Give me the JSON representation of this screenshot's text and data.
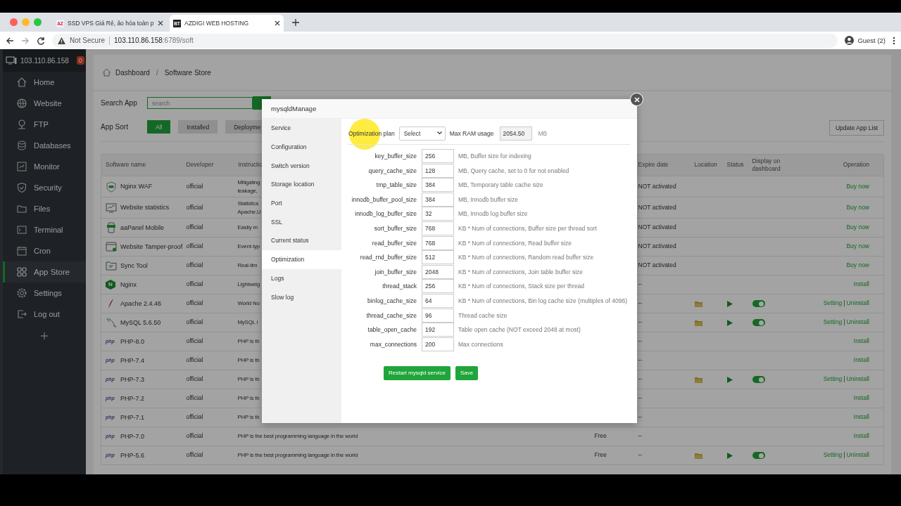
{
  "browser": {
    "tabs": [
      {
        "favicon": "AZ",
        "title": "SSD VPS Giá Rẻ, ảo hóa toàn p",
        "selected": false
      },
      {
        "favicon": "BT",
        "title": "AZDIGI WEB HOSTING",
        "selected": true
      }
    ],
    "security": "Not Secure",
    "url_host": "103.110.86.158",
    "url_rest": ":6789/soft",
    "profile": "Guest (2)"
  },
  "sidebar": {
    "host": "103.110.86.158",
    "badge": "0",
    "items": [
      {
        "label": "Home",
        "selected": false
      },
      {
        "label": "Website",
        "selected": false
      },
      {
        "label": "FTP",
        "selected": false
      },
      {
        "label": "Databases",
        "selected": false
      },
      {
        "label": "Monitor",
        "selected": false
      },
      {
        "label": "Security",
        "selected": false
      },
      {
        "label": "Files",
        "selected": false
      },
      {
        "label": "Terminal",
        "selected": false
      },
      {
        "label": "Cron",
        "selected": false
      },
      {
        "label": "App Store",
        "selected": true
      },
      {
        "label": "Settings",
        "selected": false
      },
      {
        "label": "Log out",
        "selected": false
      }
    ]
  },
  "breadcrumb": {
    "items": [
      "Dashboard",
      "Software Store"
    ],
    "separator": "/"
  },
  "search": {
    "label": "Search App",
    "placeholder": "search"
  },
  "sort": {
    "label": "App Sort",
    "options": [
      {
        "label": "All",
        "selected": true
      },
      {
        "label": "Installed",
        "selected": false
      },
      {
        "label": "Deployme",
        "selected": false
      }
    ]
  },
  "update_button": "Update App List",
  "table": {
    "columns": [
      "Software name",
      "Developer",
      "Instructio",
      "Expire date",
      "Location",
      "Status",
      "Display on dashboard",
      "Operation"
    ],
    "op_separator": "|",
    "rows": [
      {
        "name": "Nginx WAF",
        "developer": "official",
        "instruction": [
          "Mitigating",
          "leakage,"
        ],
        "expire": "NOT activated",
        "installed": false,
        "operations": [
          "Buy now"
        ]
      },
      {
        "name": "Website statistics",
        "developer": "official",
        "instruction": [
          "Statistics",
          "Apache,U"
        ],
        "expire": "NOT activated",
        "installed": false,
        "operations": [
          "Buy now"
        ]
      },
      {
        "name": "aaPanel Mobile",
        "developer": "official",
        "instruction": [
          "Easily m"
        ],
        "expire": "NOT activated",
        "installed": false,
        "operations": [
          "Buy now"
        ]
      },
      {
        "name": "Website Tamper-proof",
        "developer": "official",
        "instruction": [
          "Event-typ"
        ],
        "expire": "NOT activated",
        "installed": false,
        "operations": [
          "Buy now"
        ]
      },
      {
        "name": "Sync Tool",
        "developer": "official",
        "instruction": [
          "Real-tim"
        ],
        "expire": "NOT activated",
        "installed": false,
        "operations": [
          "Buy now"
        ]
      },
      {
        "icon_text": "N",
        "name": "Nginx",
        "developer": "official",
        "instruction": [
          "Lightweig"
        ],
        "expire": "--",
        "installed": false,
        "operations": [
          "Install"
        ]
      },
      {
        "name": "Apache 2.4.46",
        "developer": "official",
        "instruction": [
          "World No"
        ],
        "expire": "--",
        "installed": true,
        "running": true,
        "dashboard": true,
        "operations": [
          "Setting",
          "Uninstall"
        ]
      },
      {
        "name": "MySQL 5.6.50",
        "developer": "official",
        "instruction": [
          "MySQL i"
        ],
        "expire": "--",
        "installed": true,
        "running": true,
        "dashboard": true,
        "operations": [
          "Setting",
          "Uninstall"
        ]
      },
      {
        "icon_text": "php",
        "name": "PHP-8.0",
        "developer": "official",
        "instruction": [
          "PHP is th"
        ],
        "expire": "--",
        "installed": false,
        "operations": [
          "Install"
        ]
      },
      {
        "icon_text": "php",
        "name": "PHP-7.4",
        "developer": "official",
        "instruction": [
          "PHP is th"
        ],
        "expire": "--",
        "installed": false,
        "operations": [
          "Install"
        ]
      },
      {
        "icon_text": "php",
        "name": "PHP-7.3",
        "developer": "official",
        "instruction": [
          "PHP is th"
        ],
        "expire": "--",
        "installed": true,
        "running": true,
        "dashboard": true,
        "operations": [
          "Setting",
          "Uninstall"
        ]
      },
      {
        "icon_text": "php",
        "name": "PHP-7.2",
        "developer": "official",
        "instruction": [
          "PHP is th"
        ],
        "expire": "--",
        "installed": false,
        "operations": [
          "Install"
        ]
      },
      {
        "icon_text": "php",
        "name": "PHP-7.1",
        "developer": "official",
        "instruction": [
          "PHP is th"
        ],
        "expire": "--",
        "installed": false,
        "operations": [
          "Install"
        ]
      },
      {
        "icon_text": "php",
        "name": "PHP-7.0",
        "developer": "official",
        "instruction": [
          "PHP is the best programming language in the world"
        ],
        "price": "Free",
        "expire": "--",
        "installed": false,
        "operations": [
          "Install"
        ]
      },
      {
        "icon_text": "php",
        "name": "PHP-5.6",
        "developer": "official",
        "instruction": [
          "PHP is the best programming language in the world"
        ],
        "price": "Free",
        "expire": "--",
        "installed": true,
        "running": true,
        "dashboard": true,
        "operations": [
          "Setting",
          "Uninstall"
        ]
      }
    ]
  },
  "dialog": {
    "title": "mysqldManage",
    "nav": [
      {
        "label": "Service",
        "selected": false
      },
      {
        "label": "Configuration",
        "selected": false
      },
      {
        "label": "Switch version",
        "selected": false
      },
      {
        "label": "Storage location",
        "selected": false
      },
      {
        "label": "Port",
        "selected": false
      },
      {
        "label": "SSL",
        "selected": false
      },
      {
        "label": "Current status",
        "selected": false
      },
      {
        "label": "Optimization",
        "selected": true
      },
      {
        "label": "Logs",
        "selected": false
      },
      {
        "label": "Slow log",
        "selected": false
      }
    ],
    "plan_label": "Optimization plan",
    "plan_select": "Select",
    "ram_label": "Max RAM usage",
    "ram_value": "2054.50",
    "ram_unit": "MB",
    "params": [
      {
        "name": "key_buffer_size",
        "value": "256",
        "desc": "MB, Buffer size for indexing"
      },
      {
        "name": "query_cache_size",
        "value": "128",
        "desc": "MB, Query cache, set to 0 for not enabled"
      },
      {
        "name": "tmp_table_size",
        "value": "384",
        "desc": "MB, Temporary table cache size"
      },
      {
        "name": "innodb_buffer_pool_size",
        "value": "384",
        "desc": "MB, Innodb buffer size"
      },
      {
        "name": "innodb_log_buffer_size",
        "value": "32",
        "desc": "MB, Innodb log buffer size"
      },
      {
        "name": "sort_buffer_size",
        "value": "768",
        "desc": "KB * Num of connections, Buffer size per thread sort"
      },
      {
        "name": "read_buffer_size",
        "value": "768",
        "desc": "KB * Num of connections, Read buffer size"
      },
      {
        "name": "read_rnd_buffer_size",
        "value": "512",
        "desc": "KB * Num of connections, Random read buffer size"
      },
      {
        "name": "join_buffer_size",
        "value": "2048",
        "desc": "KB * Num of connections, Join table buffer size"
      },
      {
        "name": "thread_stack",
        "value": "256",
        "desc": "KB * Num of connections, Stack size per thread"
      },
      {
        "name": "binlog_cache_size",
        "value": "64",
        "desc": "KB * Num of connections, Bin log cache size (multiples of 4096)"
      },
      {
        "name": "thread_cache_size",
        "value": "96",
        "desc": "Thread cache size"
      },
      {
        "name": "table_open_cache",
        "value": "192",
        "desc": "Table open cache (NOT exceed 2048 at most)"
      },
      {
        "name": "max_connections",
        "value": "200",
        "desc": "Max connections"
      }
    ],
    "buttons": [
      "Restart mysqld service",
      "Save"
    ]
  }
}
